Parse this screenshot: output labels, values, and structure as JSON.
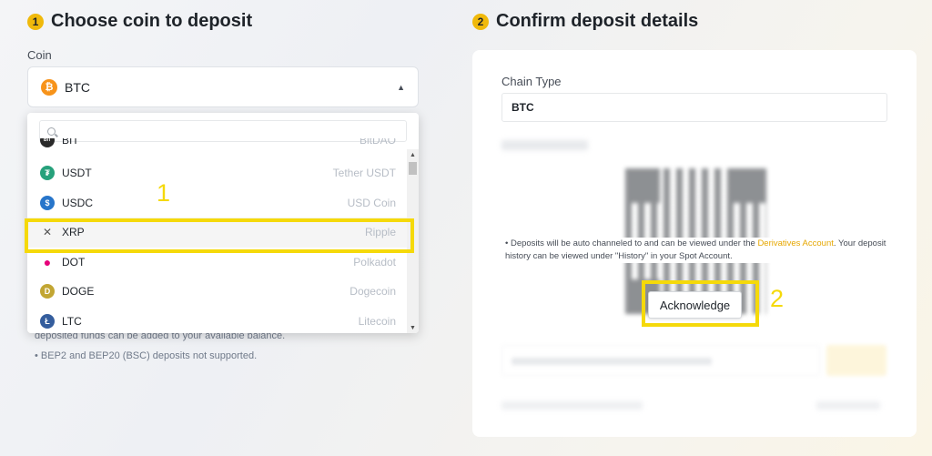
{
  "step1": {
    "num": "1",
    "title": "Choose coin to deposit"
  },
  "step2": {
    "num": "2",
    "title": "Confirm deposit details"
  },
  "coin_field": {
    "label": "Coin",
    "selected_symbol": "BTC",
    "selected_icon_glyph": "₿"
  },
  "dropdown": {
    "search_placeholder": "",
    "items": [
      {
        "symbol": "BIT",
        "name": "BitDAO",
        "icon": "bitdao-icon",
        "color": "#2a2a2a",
        "glyph": "BIT"
      },
      {
        "symbol": "USDT",
        "name": "Tether USDT",
        "icon": "tether-icon",
        "color": "#26a17b",
        "glyph": "₮"
      },
      {
        "symbol": "USDC",
        "name": "USD Coin",
        "icon": "usdc-icon",
        "color": "#2775ca",
        "glyph": "$"
      },
      {
        "symbol": "XRP",
        "name": "Ripple",
        "icon": "xrp-icon",
        "color": "#555555",
        "glyph": "✕"
      },
      {
        "symbol": "DOT",
        "name": "Polkadot",
        "icon": "polkadot-icon",
        "color": "#e6007a",
        "glyph": "●"
      },
      {
        "symbol": "DOGE",
        "name": "Dogecoin",
        "icon": "dogecoin-icon",
        "color": "#c2a633",
        "glyph": "D"
      },
      {
        "symbol": "LTC",
        "name": "Litecoin",
        "icon": "litecoin-icon",
        "color": "#345d9d",
        "glyph": "Ł"
      }
    ]
  },
  "left_hints": [
    "deposited funds can be added to your available balance.",
    "• BEP2 and BEP20 (BSC) deposits not supported."
  ],
  "chain": {
    "label": "Chain Type",
    "value": "BTC"
  },
  "notice": {
    "prefix": "• Deposits will be auto channeled to and can be viewed under the ",
    "link": "Derivatives Account",
    "suffix": ". Your deposit history can be viewed under \"History\" in your Spot Account."
  },
  "acknowledge_label": "Acknowledge",
  "annotations": {
    "one": "1",
    "two": "2"
  },
  "colors": {
    "accent": "#f0b90b",
    "highlight": "#f5d90a",
    "link": "#e6a700"
  }
}
